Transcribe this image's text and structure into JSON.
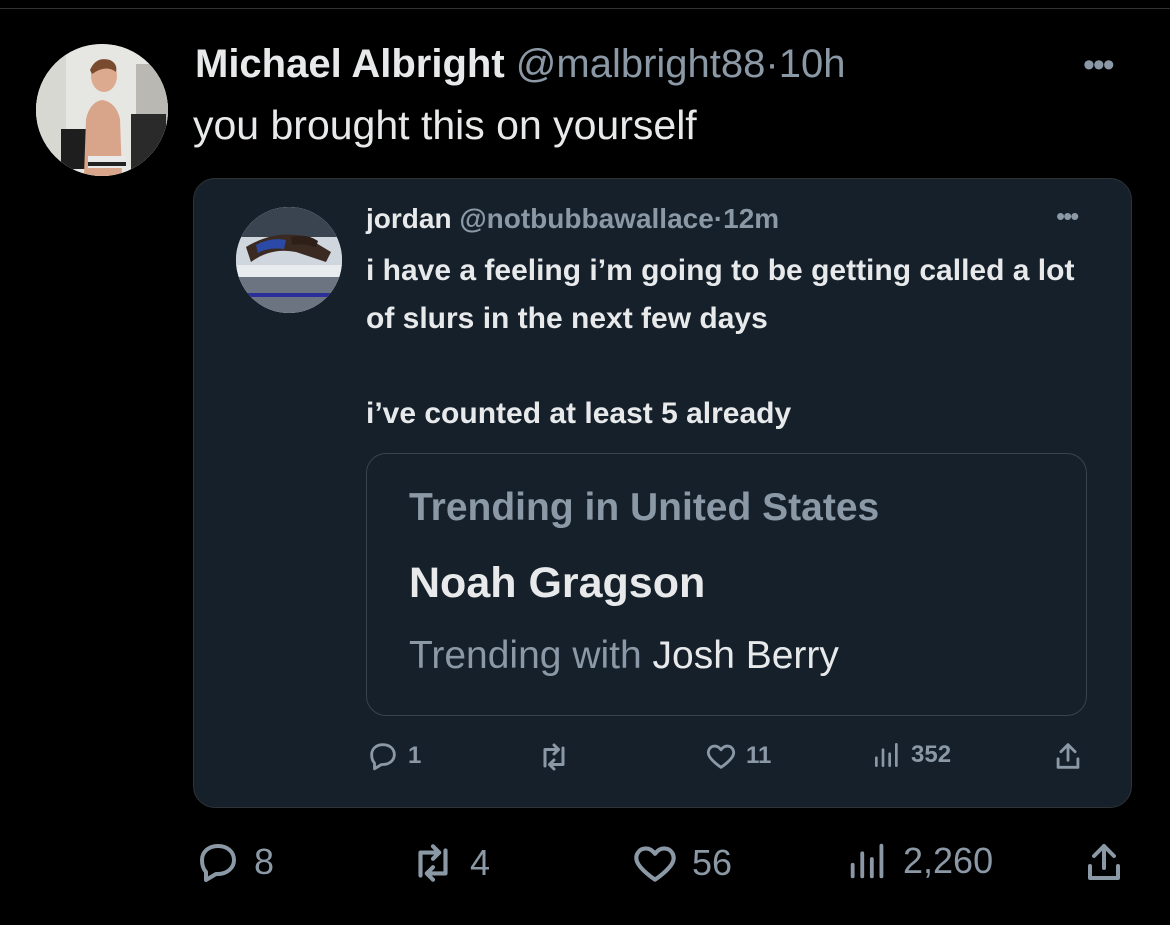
{
  "tweet": {
    "display_name": "Michael Albright",
    "handle": "@malbright88",
    "separator": "·",
    "time": "10h",
    "text": "you brought this on yourself",
    "more_icon": "more-horizontal-icon",
    "stats": {
      "replies": "8",
      "retweets": "4",
      "likes": "56",
      "views": "2,260"
    }
  },
  "quoted_tweet": {
    "display_name": "jordan",
    "handle": "@notbubbawallace",
    "separator": "·",
    "time": "12m",
    "text_line1": "i have a feeling i’m going to be getting called a lot of slurs in the next few days",
    "text_line2": "i’ve counted at least 5 already",
    "card": {
      "kicker": "Trending in United States",
      "title": "Noah Gragson",
      "subtitle_prefix": "Trending with",
      "subtitle_topic": "Josh Berry"
    },
    "stats": {
      "replies": "1",
      "retweets": "",
      "likes": "11",
      "views": "352"
    }
  },
  "colors": {
    "background": "#000000",
    "quote_background": "#15202b",
    "text_primary": "#e7e9ea",
    "text_secondary": "#8b98a5"
  }
}
